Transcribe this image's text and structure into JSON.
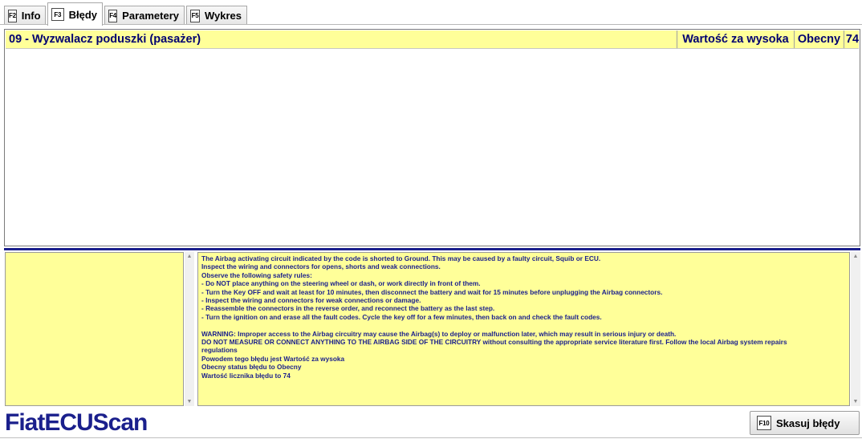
{
  "tabs": [
    {
      "key": "F2",
      "label": "Info",
      "active": false
    },
    {
      "key": "F3",
      "label": "Błędy",
      "active": true
    },
    {
      "key": "F4",
      "label": "Parametery",
      "active": false
    },
    {
      "key": "F5",
      "label": "Wykres",
      "active": false
    }
  ],
  "fault": {
    "name": "09 - Wyzwalacz poduszki (pasażer)",
    "type": "Wartość za wysoka",
    "status": "Obecny",
    "count": "74"
  },
  "description": [
    "The Airbag activating circuit indicated by the code is shorted to Ground. This may be caused by a faulty circuit, Squib or ECU.",
    "Inspect the wiring and connectors for opens, shorts and weak connections.",
    "Observe the following safety rules:",
    "- Do NOT place anything on the steering wheel or dash, or work directly in front of them.",
    "- Turn the Key OFF and wait at least for 10 minutes, then disconnect the battery and wait for 15 minutes before unplugging the Airbag connectors.",
    "- Inspect the wiring and connectors for weak connections or damage.",
    "- Reassemble the connectors in the reverse order, and reconnect the battery as the last step.",
    "- Turn the ignition on and erase all the fault codes. Cycle the key off for a few minutes, then back on and check the fault codes.",
    "",
    "WARNING: Improper access to the Airbag circuitry may cause the Airbag(s) to deploy or malfunction later, which may result in serious injury or death.",
    "DO NOT MEASURE OR CONNECT ANYTHING TO THE AIRBAG SIDE OF THE CIRCUITRY without consulting the appropriate service literature first. Follow the local Airbag system repairs",
    "regulations",
    "Powodem tego błędu jest Wartość za wysoka",
    "Obecny status błędu to Obecny",
    "Wartość licznika błędu to 74"
  ],
  "logo": "FiatECUScan",
  "clear_button": {
    "key": "F10",
    "label": "Skasuj błędy"
  },
  "colors": {
    "accent": "#1a1f8c",
    "highlight": "#ffff99"
  },
  "icons": {
    "scroll_up": "▲",
    "scroll_down": "▼"
  }
}
